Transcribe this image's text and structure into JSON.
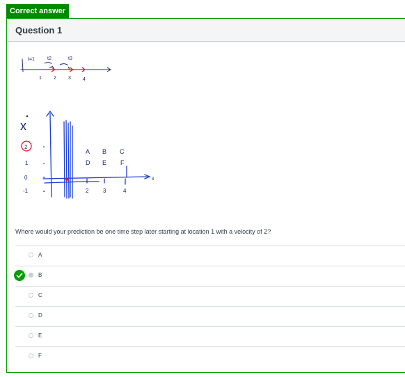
{
  "badge": {
    "label": "Correct answer"
  },
  "question": {
    "title": "Question 1",
    "prompt": "Where would your prediction be one time step later starting at location 1 with a velocity of 2?"
  },
  "sketch1": {
    "top_labels": [
      "t=1",
      "t2",
      "t3"
    ],
    "axis_labels": [
      "1",
      "2",
      "3",
      "4"
    ]
  },
  "sketch2": {
    "y_title": "x",
    "y_labels": [
      "2",
      "1",
      "0",
      "-1"
    ],
    "grid_letters_top": [
      "A",
      "B",
      "C"
    ],
    "grid_letters_bottom": [
      "D",
      "E",
      "F"
    ],
    "x_labels": [
      "2",
      "3",
      "4"
    ],
    "x_axis_label": "x"
  },
  "answers": [
    {
      "label": "A",
      "selected": false,
      "correct": false
    },
    {
      "label": "B",
      "selected": true,
      "correct": true
    },
    {
      "label": "C",
      "selected": false,
      "correct": false
    },
    {
      "label": "D",
      "selected": false,
      "correct": false
    },
    {
      "label": "E",
      "selected": false,
      "correct": false
    },
    {
      "label": "F",
      "selected": false,
      "correct": false
    }
  ],
  "colors": {
    "correct": "#008a00",
    "ink": "#1a3fd6",
    "highlight": "#e0162b"
  }
}
